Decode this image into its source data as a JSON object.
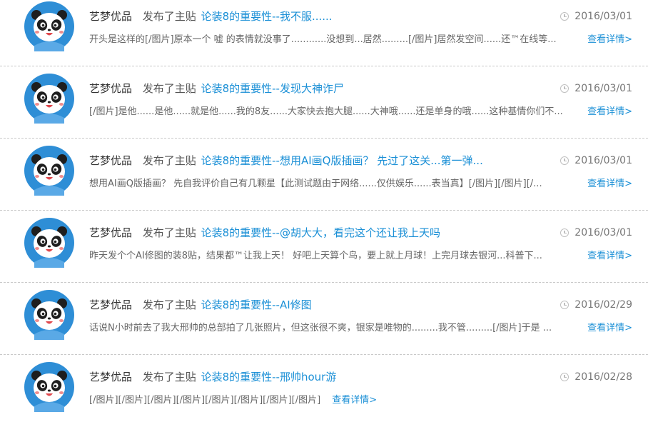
{
  "colors": {
    "link": "#1a8fd6",
    "avatar_bg": "#2e8ed6",
    "divider": "#c9c9c9"
  },
  "icons": {
    "avatar": "panda-avatar-icon",
    "date": "clock-icon"
  },
  "posts": [
    {
      "author": "艺梦优品",
      "action": "发布了主贴",
      "title": "论装8的重要性--我不服......",
      "date": "2016/03/01",
      "excerpt": "开头是这样的[/图片]原本一个 嘘 的表情就没事了............没想到...居然.........[/图片]居然发空间......还™在线等...",
      "more": "查看详情>"
    },
    {
      "author": "艺梦优品",
      "action": "发布了主贴",
      "title": "论装8的重要性--发现大神诈尸",
      "date": "2016/03/01",
      "excerpt": "[/图片]是他......是他......就是他......我的8友......大家快去抱大腿......大神哦......还是单身的哦......这种基情你们不...",
      "more": "查看详情>"
    },
    {
      "author": "艺梦优品",
      "action": "发布了主贴",
      "title": "论装8的重要性--想用AI画Q版插画？ 先过了这关...第一弹...",
      "date": "2016/03/01",
      "excerpt": "想用AI画Q版插画？ 先自我评价自己有几颗星【此测试题由于网络......仅供娱乐......表当真】[/图片][/图片][/...",
      "more": "查看详情>"
    },
    {
      "author": "艺梦优品",
      "action": "发布了主贴",
      "title": "论装8的重要性--@胡大大，看完这个还让我上天吗",
      "date": "2016/03/01",
      "excerpt": "昨天发个个AI修图的装8贴，结果都™让我上天！ 好吧上天算个鸟，要上就上月球！上完月球去银河...科普下...",
      "more": "查看详情>"
    },
    {
      "author": "艺梦优品",
      "action": "发布了主贴",
      "title": "论装8的重要性--AI修图",
      "date": "2016/02/29",
      "excerpt": "话说N小时前去了我大邢帅的总部拍了几张照片，但这张很不爽，银家是唯物的.........我不管.........[/图片]于是 ...",
      "more": "查看详情>"
    },
    {
      "author": "艺梦优品",
      "action": "发布了主贴",
      "title": "论装8的重要性--邢帅hour游",
      "date": "2016/02/28",
      "excerpt": "[/图片][/图片][/图片][/图片][/图片][/图片][/图片][/图片]",
      "more": "查看详情>"
    }
  ]
}
